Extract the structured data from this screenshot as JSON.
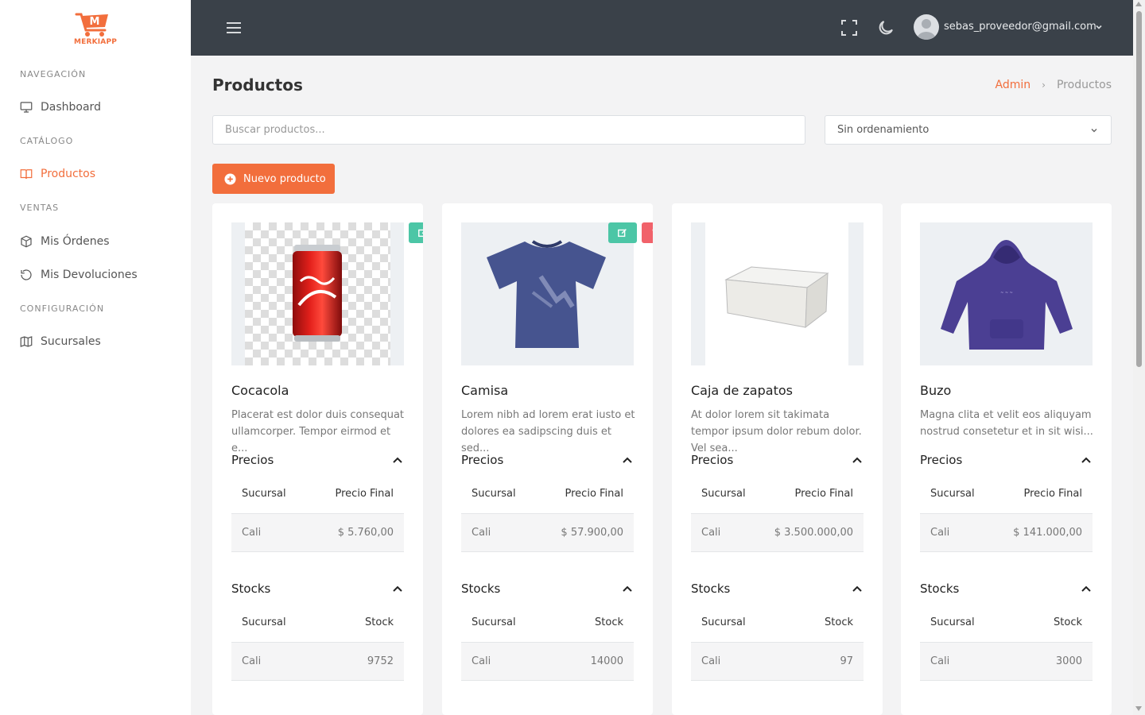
{
  "app": {
    "logo_text": "MERKIAPP",
    "logo_letter": "M"
  },
  "sidebar": {
    "sections": [
      {
        "label": "NAVEGACIÓN"
      },
      {
        "label": "CATÁLOGO"
      },
      {
        "label": "VENTAS"
      },
      {
        "label": "CONFIGURACIÓN"
      }
    ],
    "items": [
      {
        "label": "Dashboard",
        "icon": "monitor-icon"
      },
      {
        "label": "Productos",
        "icon": "book-icon",
        "active": true
      },
      {
        "label": "Mis Órdenes",
        "icon": "box-icon"
      },
      {
        "label": "Mis Devoluciones",
        "icon": "undo-icon"
      },
      {
        "label": "Sucursales",
        "icon": "map-icon"
      }
    ]
  },
  "topbar": {
    "user_email": "sebas_proveedor@gmail.com"
  },
  "page": {
    "title": "Productos",
    "breadcrumb": {
      "link": "Admin",
      "current": "Productos"
    },
    "search_placeholder": "Buscar productos...",
    "sort_selected": "Sin ordenamiento",
    "new_button": "Nuevo producto"
  },
  "labels": {
    "prices": "Precios",
    "stocks": "Stocks",
    "col_branch": "Sucursal",
    "col_price": "Precio Final",
    "col_stock": "Stock"
  },
  "products": [
    {
      "name": "Cocacola",
      "desc": "Placerat est dolor duis consequat ullamcorper. Tempor eirmod et e...",
      "branch": "Cali",
      "price": "$ 5.760,00",
      "stock": "9752"
    },
    {
      "name": "Camisa",
      "desc": "Lorem nibh ad lorem erat iusto et dolores ea sadipscing duis et sed...",
      "branch": "Cali",
      "price": "$ 57.900,00",
      "stock": "14000"
    },
    {
      "name": "Caja de zapatos",
      "desc": "At dolor lorem sit takimata tempor ipsum dolor rebum dolor. Vel sea...",
      "branch": "Cali",
      "price": "$ 3.500.000,00",
      "stock": "97"
    },
    {
      "name": "Buzo",
      "desc": "Magna clita et velit eos aliquyam nostrud consetetur et in sit wisi...",
      "branch": "Cali",
      "price": "$ 141.000,00",
      "stock": "3000"
    }
  ],
  "colors": {
    "accent": "#f26e3c",
    "topbar": "#3a4149",
    "edit": "#4cc6a6",
    "delete": "#f1626a"
  }
}
